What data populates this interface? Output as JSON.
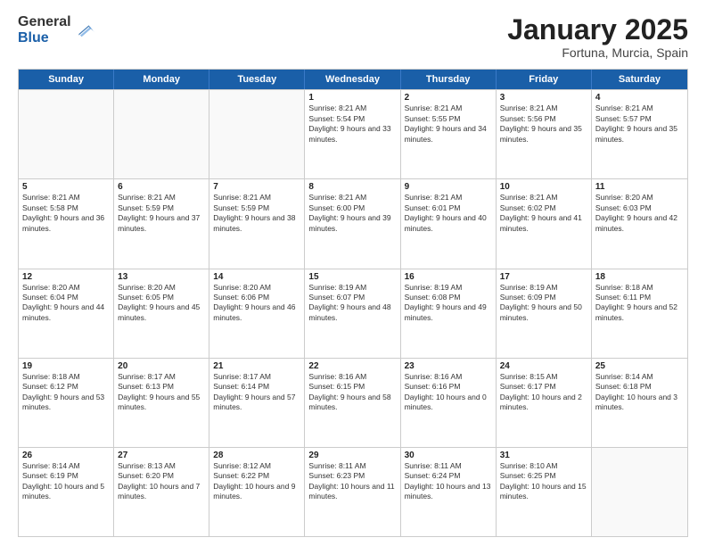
{
  "logo": {
    "general": "General",
    "blue": "Blue"
  },
  "title": "January 2025",
  "subtitle": "Fortuna, Murcia, Spain",
  "header_days": [
    "Sunday",
    "Monday",
    "Tuesday",
    "Wednesday",
    "Thursday",
    "Friday",
    "Saturday"
  ],
  "weeks": [
    [
      {
        "day": "",
        "sunrise": "",
        "sunset": "",
        "daylight": ""
      },
      {
        "day": "",
        "sunrise": "",
        "sunset": "",
        "daylight": ""
      },
      {
        "day": "",
        "sunrise": "",
        "sunset": "",
        "daylight": ""
      },
      {
        "day": "1",
        "sunrise": "Sunrise: 8:21 AM",
        "sunset": "Sunset: 5:54 PM",
        "daylight": "Daylight: 9 hours and 33 minutes."
      },
      {
        "day": "2",
        "sunrise": "Sunrise: 8:21 AM",
        "sunset": "Sunset: 5:55 PM",
        "daylight": "Daylight: 9 hours and 34 minutes."
      },
      {
        "day": "3",
        "sunrise": "Sunrise: 8:21 AM",
        "sunset": "Sunset: 5:56 PM",
        "daylight": "Daylight: 9 hours and 35 minutes."
      },
      {
        "day": "4",
        "sunrise": "Sunrise: 8:21 AM",
        "sunset": "Sunset: 5:57 PM",
        "daylight": "Daylight: 9 hours and 35 minutes."
      }
    ],
    [
      {
        "day": "5",
        "sunrise": "Sunrise: 8:21 AM",
        "sunset": "Sunset: 5:58 PM",
        "daylight": "Daylight: 9 hours and 36 minutes."
      },
      {
        "day": "6",
        "sunrise": "Sunrise: 8:21 AM",
        "sunset": "Sunset: 5:59 PM",
        "daylight": "Daylight: 9 hours and 37 minutes."
      },
      {
        "day": "7",
        "sunrise": "Sunrise: 8:21 AM",
        "sunset": "Sunset: 5:59 PM",
        "daylight": "Daylight: 9 hours and 38 minutes."
      },
      {
        "day": "8",
        "sunrise": "Sunrise: 8:21 AM",
        "sunset": "Sunset: 6:00 PM",
        "daylight": "Daylight: 9 hours and 39 minutes."
      },
      {
        "day": "9",
        "sunrise": "Sunrise: 8:21 AM",
        "sunset": "Sunset: 6:01 PM",
        "daylight": "Daylight: 9 hours and 40 minutes."
      },
      {
        "day": "10",
        "sunrise": "Sunrise: 8:21 AM",
        "sunset": "Sunset: 6:02 PM",
        "daylight": "Daylight: 9 hours and 41 minutes."
      },
      {
        "day": "11",
        "sunrise": "Sunrise: 8:20 AM",
        "sunset": "Sunset: 6:03 PM",
        "daylight": "Daylight: 9 hours and 42 minutes."
      }
    ],
    [
      {
        "day": "12",
        "sunrise": "Sunrise: 8:20 AM",
        "sunset": "Sunset: 6:04 PM",
        "daylight": "Daylight: 9 hours and 44 minutes."
      },
      {
        "day": "13",
        "sunrise": "Sunrise: 8:20 AM",
        "sunset": "Sunset: 6:05 PM",
        "daylight": "Daylight: 9 hours and 45 minutes."
      },
      {
        "day": "14",
        "sunrise": "Sunrise: 8:20 AM",
        "sunset": "Sunset: 6:06 PM",
        "daylight": "Daylight: 9 hours and 46 minutes."
      },
      {
        "day": "15",
        "sunrise": "Sunrise: 8:19 AM",
        "sunset": "Sunset: 6:07 PM",
        "daylight": "Daylight: 9 hours and 48 minutes."
      },
      {
        "day": "16",
        "sunrise": "Sunrise: 8:19 AM",
        "sunset": "Sunset: 6:08 PM",
        "daylight": "Daylight: 9 hours and 49 minutes."
      },
      {
        "day": "17",
        "sunrise": "Sunrise: 8:19 AM",
        "sunset": "Sunset: 6:09 PM",
        "daylight": "Daylight: 9 hours and 50 minutes."
      },
      {
        "day": "18",
        "sunrise": "Sunrise: 8:18 AM",
        "sunset": "Sunset: 6:11 PM",
        "daylight": "Daylight: 9 hours and 52 minutes."
      }
    ],
    [
      {
        "day": "19",
        "sunrise": "Sunrise: 8:18 AM",
        "sunset": "Sunset: 6:12 PM",
        "daylight": "Daylight: 9 hours and 53 minutes."
      },
      {
        "day": "20",
        "sunrise": "Sunrise: 8:17 AM",
        "sunset": "Sunset: 6:13 PM",
        "daylight": "Daylight: 9 hours and 55 minutes."
      },
      {
        "day": "21",
        "sunrise": "Sunrise: 8:17 AM",
        "sunset": "Sunset: 6:14 PM",
        "daylight": "Daylight: 9 hours and 57 minutes."
      },
      {
        "day": "22",
        "sunrise": "Sunrise: 8:16 AM",
        "sunset": "Sunset: 6:15 PM",
        "daylight": "Daylight: 9 hours and 58 minutes."
      },
      {
        "day": "23",
        "sunrise": "Sunrise: 8:16 AM",
        "sunset": "Sunset: 6:16 PM",
        "daylight": "Daylight: 10 hours and 0 minutes."
      },
      {
        "day": "24",
        "sunrise": "Sunrise: 8:15 AM",
        "sunset": "Sunset: 6:17 PM",
        "daylight": "Daylight: 10 hours and 2 minutes."
      },
      {
        "day": "25",
        "sunrise": "Sunrise: 8:14 AM",
        "sunset": "Sunset: 6:18 PM",
        "daylight": "Daylight: 10 hours and 3 minutes."
      }
    ],
    [
      {
        "day": "26",
        "sunrise": "Sunrise: 8:14 AM",
        "sunset": "Sunset: 6:19 PM",
        "daylight": "Daylight: 10 hours and 5 minutes."
      },
      {
        "day": "27",
        "sunrise": "Sunrise: 8:13 AM",
        "sunset": "Sunset: 6:20 PM",
        "daylight": "Daylight: 10 hours and 7 minutes."
      },
      {
        "day": "28",
        "sunrise": "Sunrise: 8:12 AM",
        "sunset": "Sunset: 6:22 PM",
        "daylight": "Daylight: 10 hours and 9 minutes."
      },
      {
        "day": "29",
        "sunrise": "Sunrise: 8:11 AM",
        "sunset": "Sunset: 6:23 PM",
        "daylight": "Daylight: 10 hours and 11 minutes."
      },
      {
        "day": "30",
        "sunrise": "Sunrise: 8:11 AM",
        "sunset": "Sunset: 6:24 PM",
        "daylight": "Daylight: 10 hours and 13 minutes."
      },
      {
        "day": "31",
        "sunrise": "Sunrise: 8:10 AM",
        "sunset": "Sunset: 6:25 PM",
        "daylight": "Daylight: 10 hours and 15 minutes."
      },
      {
        "day": "",
        "sunrise": "",
        "sunset": "",
        "daylight": ""
      }
    ]
  ]
}
